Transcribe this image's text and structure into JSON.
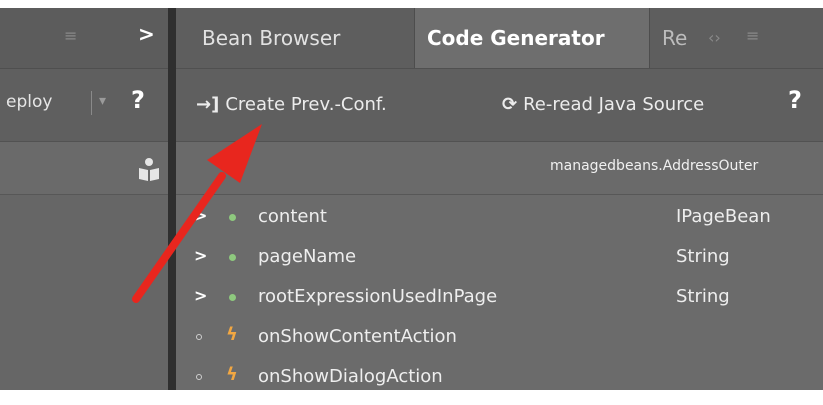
{
  "left_panel": {
    "menu_icon": "hamburger-icon",
    "chevron_icon": "chevron-right-icon",
    "deploy_label": "eploy",
    "deploy_caret_icon": "caret-down-icon",
    "help_label": "?",
    "person_icon": "person-book-icon"
  },
  "tabs": {
    "items": [
      {
        "label": "Bean Browser",
        "active": false
      },
      {
        "label": "Code Generator",
        "active": true
      },
      {
        "label": "Re",
        "active": false
      }
    ],
    "arrows_label": "‹›",
    "menu_label": "≡"
  },
  "toolbar": {
    "create_label": "Create Prev.-Conf.",
    "create_icon": "enter-arrow-icon",
    "reread_label": "Re-read Java Source",
    "reread_icon": "refresh-icon",
    "help_label": "?"
  },
  "path": {
    "text": "managedbeans.AddressOuter"
  },
  "members": [
    {
      "kind": "property",
      "expandable": false,
      "name": "content",
      "type": "IPageBean"
    },
    {
      "kind": "property",
      "expandable": true,
      "name": "pageName",
      "type": "String"
    },
    {
      "kind": "property",
      "expandable": true,
      "name": "rootExpressionUsedInPage",
      "type": "String"
    },
    {
      "kind": "action",
      "expandable": false,
      "name": "onShowContentAction",
      "type": ""
    },
    {
      "kind": "action",
      "expandable": false,
      "name": "onShowDialogAction",
      "type": ""
    }
  ],
  "colors": {
    "property_dot": "#8ec97e",
    "action_bolt": "#f2a742",
    "annotation_arrow": "#e8261e"
  }
}
